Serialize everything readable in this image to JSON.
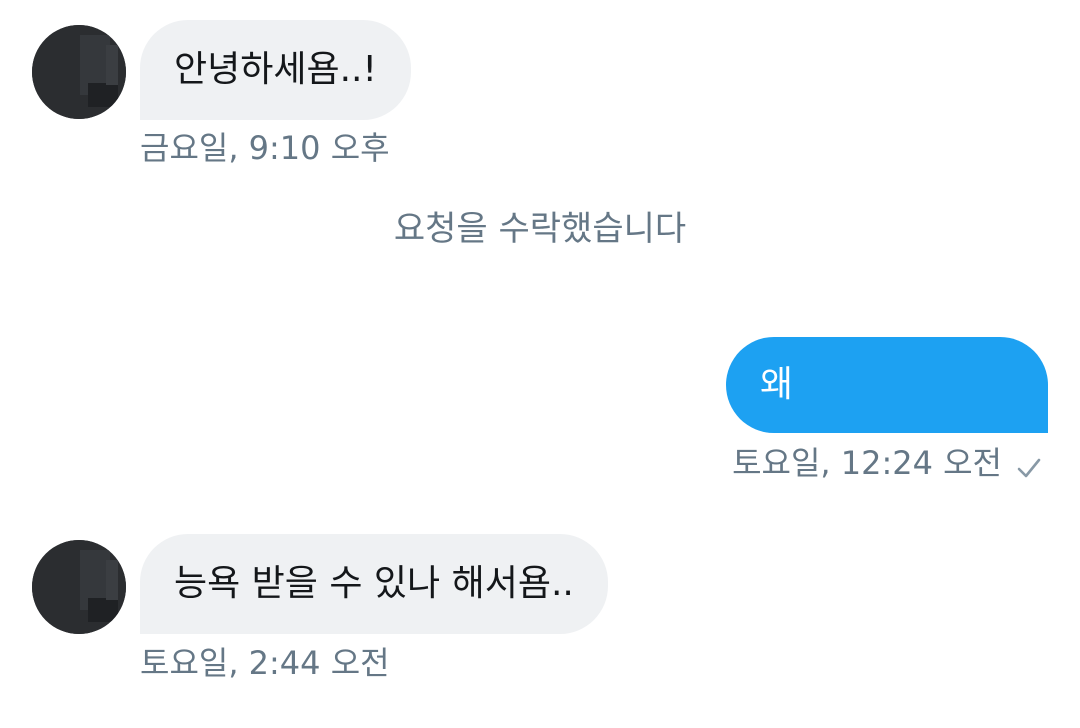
{
  "messages": [
    {
      "text": "안녕하세욤..!",
      "timestamp": "금요일, 9:10 오후"
    },
    {
      "text": "왜",
      "timestamp": "토요일, 12:24 오전"
    },
    {
      "text": "능욕 받을 수 있나 해서욤..",
      "timestamp": "토요일, 2:44 오전"
    }
  ],
  "system_message": "요청을 수락했습니다",
  "colors": {
    "incoming_bubble": "#eff1f3",
    "outgoing_bubble": "#1da1f2",
    "meta_text": "#657786",
    "avatar": "#2b2d30"
  },
  "icons": {
    "sent_status": "check-icon",
    "avatar": "avatar-image"
  }
}
